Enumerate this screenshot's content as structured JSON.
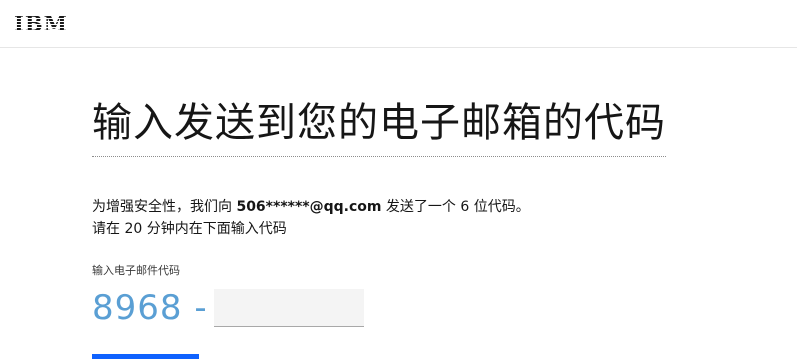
{
  "header": {
    "logo_text": "IBM"
  },
  "main": {
    "title": "输入发送到您的电子邮箱的代码",
    "description_line1_prefix": "为增强安全性，我们向 ",
    "description_email": "506******@qq.com",
    "description_line1_suffix": " 发送了一个 6 位代码。",
    "description_line2": "请在 20 分钟内在下面输入代码",
    "field_label": "输入电子邮件代码",
    "code_prefix": "8968 -",
    "code_input_value": ""
  },
  "colors": {
    "code_prefix": "#5a9fd4",
    "primary_button": "#0f62fe"
  }
}
